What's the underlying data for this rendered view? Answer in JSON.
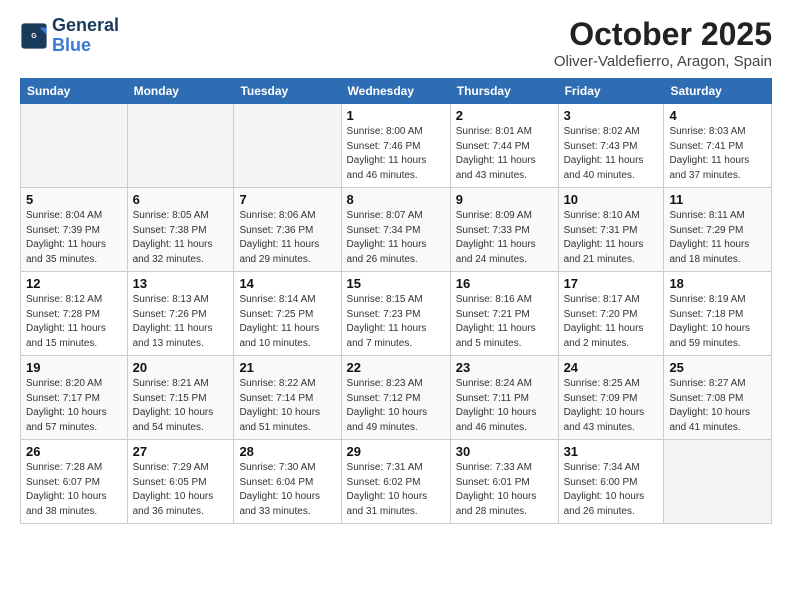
{
  "header": {
    "logo_line1": "General",
    "logo_line2": "Blue",
    "month": "October 2025",
    "location": "Oliver-Valdefierro, Aragon, Spain"
  },
  "weekdays": [
    "Sunday",
    "Monday",
    "Tuesday",
    "Wednesday",
    "Thursday",
    "Friday",
    "Saturday"
  ],
  "weeks": [
    [
      {
        "day": "",
        "info": ""
      },
      {
        "day": "",
        "info": ""
      },
      {
        "day": "",
        "info": ""
      },
      {
        "day": "1",
        "info": "Sunrise: 8:00 AM\nSunset: 7:46 PM\nDaylight: 11 hours\nand 46 minutes."
      },
      {
        "day": "2",
        "info": "Sunrise: 8:01 AM\nSunset: 7:44 PM\nDaylight: 11 hours\nand 43 minutes."
      },
      {
        "day": "3",
        "info": "Sunrise: 8:02 AM\nSunset: 7:43 PM\nDaylight: 11 hours\nand 40 minutes."
      },
      {
        "day": "4",
        "info": "Sunrise: 8:03 AM\nSunset: 7:41 PM\nDaylight: 11 hours\nand 37 minutes."
      }
    ],
    [
      {
        "day": "5",
        "info": "Sunrise: 8:04 AM\nSunset: 7:39 PM\nDaylight: 11 hours\nand 35 minutes."
      },
      {
        "day": "6",
        "info": "Sunrise: 8:05 AM\nSunset: 7:38 PM\nDaylight: 11 hours\nand 32 minutes."
      },
      {
        "day": "7",
        "info": "Sunrise: 8:06 AM\nSunset: 7:36 PM\nDaylight: 11 hours\nand 29 minutes."
      },
      {
        "day": "8",
        "info": "Sunrise: 8:07 AM\nSunset: 7:34 PM\nDaylight: 11 hours\nand 26 minutes."
      },
      {
        "day": "9",
        "info": "Sunrise: 8:09 AM\nSunset: 7:33 PM\nDaylight: 11 hours\nand 24 minutes."
      },
      {
        "day": "10",
        "info": "Sunrise: 8:10 AM\nSunset: 7:31 PM\nDaylight: 11 hours\nand 21 minutes."
      },
      {
        "day": "11",
        "info": "Sunrise: 8:11 AM\nSunset: 7:29 PM\nDaylight: 11 hours\nand 18 minutes."
      }
    ],
    [
      {
        "day": "12",
        "info": "Sunrise: 8:12 AM\nSunset: 7:28 PM\nDaylight: 11 hours\nand 15 minutes."
      },
      {
        "day": "13",
        "info": "Sunrise: 8:13 AM\nSunset: 7:26 PM\nDaylight: 11 hours\nand 13 minutes."
      },
      {
        "day": "14",
        "info": "Sunrise: 8:14 AM\nSunset: 7:25 PM\nDaylight: 11 hours\nand 10 minutes."
      },
      {
        "day": "15",
        "info": "Sunrise: 8:15 AM\nSunset: 7:23 PM\nDaylight: 11 hours\nand 7 minutes."
      },
      {
        "day": "16",
        "info": "Sunrise: 8:16 AM\nSunset: 7:21 PM\nDaylight: 11 hours\nand 5 minutes."
      },
      {
        "day": "17",
        "info": "Sunrise: 8:17 AM\nSunset: 7:20 PM\nDaylight: 11 hours\nand 2 minutes."
      },
      {
        "day": "18",
        "info": "Sunrise: 8:19 AM\nSunset: 7:18 PM\nDaylight: 10 hours\nand 59 minutes."
      }
    ],
    [
      {
        "day": "19",
        "info": "Sunrise: 8:20 AM\nSunset: 7:17 PM\nDaylight: 10 hours\nand 57 minutes."
      },
      {
        "day": "20",
        "info": "Sunrise: 8:21 AM\nSunset: 7:15 PM\nDaylight: 10 hours\nand 54 minutes."
      },
      {
        "day": "21",
        "info": "Sunrise: 8:22 AM\nSunset: 7:14 PM\nDaylight: 10 hours\nand 51 minutes."
      },
      {
        "day": "22",
        "info": "Sunrise: 8:23 AM\nSunset: 7:12 PM\nDaylight: 10 hours\nand 49 minutes."
      },
      {
        "day": "23",
        "info": "Sunrise: 8:24 AM\nSunset: 7:11 PM\nDaylight: 10 hours\nand 46 minutes."
      },
      {
        "day": "24",
        "info": "Sunrise: 8:25 AM\nSunset: 7:09 PM\nDaylight: 10 hours\nand 43 minutes."
      },
      {
        "day": "25",
        "info": "Sunrise: 8:27 AM\nSunset: 7:08 PM\nDaylight: 10 hours\nand 41 minutes."
      }
    ],
    [
      {
        "day": "26",
        "info": "Sunrise: 7:28 AM\nSunset: 6:07 PM\nDaylight: 10 hours\nand 38 minutes."
      },
      {
        "day": "27",
        "info": "Sunrise: 7:29 AM\nSunset: 6:05 PM\nDaylight: 10 hours\nand 36 minutes."
      },
      {
        "day": "28",
        "info": "Sunrise: 7:30 AM\nSunset: 6:04 PM\nDaylight: 10 hours\nand 33 minutes."
      },
      {
        "day": "29",
        "info": "Sunrise: 7:31 AM\nSunset: 6:02 PM\nDaylight: 10 hours\nand 31 minutes."
      },
      {
        "day": "30",
        "info": "Sunrise: 7:33 AM\nSunset: 6:01 PM\nDaylight: 10 hours\nand 28 minutes."
      },
      {
        "day": "31",
        "info": "Sunrise: 7:34 AM\nSunset: 6:00 PM\nDaylight: 10 hours\nand 26 minutes."
      },
      {
        "day": "",
        "info": ""
      }
    ]
  ]
}
